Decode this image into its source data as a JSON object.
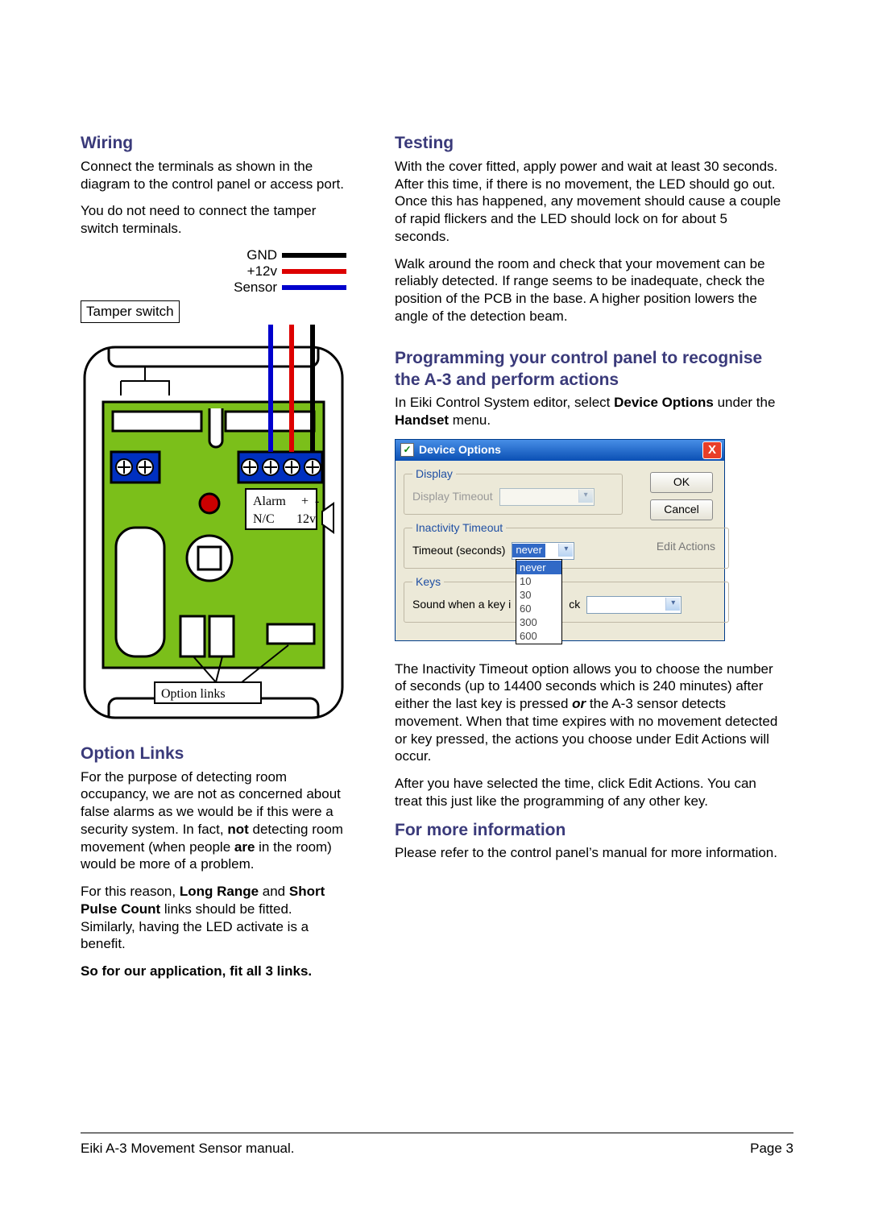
{
  "left": {
    "wiring_h": "Wiring",
    "wiring_p1": "Connect the terminals as shown in the diagram to the control panel or access port.",
    "wiring_p2": "You do not need to connect the tamper switch terminals.",
    "legend_gnd": "GND",
    "legend_12v": "+12v",
    "legend_sensor": "Sensor",
    "tamper_label": "Tamper switch",
    "diagram_alarm": "Alarm",
    "diagram_nc": "N/C",
    "diagram_plus": "+",
    "diagram_minus": "-",
    "diagram_12v": "12v",
    "option_links_box": "Option links",
    "option_links_h": "Option Links",
    "ol_p1_pre": "For the purpose of detecting room occupancy, we are not as concerned about false alarms as we would be if this were a security system. In fact, ",
    "ol_p1_not": "not",
    "ol_p1_mid": " detecting room movement (when people ",
    "ol_p1_are": "are",
    "ol_p1_post": " in the room) would be more of a problem.",
    "ol_p2_pre": "For this reason, ",
    "ol_p2_lr": "Long Range",
    "ol_p2_mid": " and ",
    "ol_p2_spc": "Short Pulse Count",
    "ol_p2_post": " links should be fitted. Similarly, having the LED activate is a benefit.",
    "ol_p3": "So for our application, fit all 3 links."
  },
  "right": {
    "testing_h": "Testing",
    "testing_p1": "With the cover fitted, apply power and wait at least 30 seconds. After this time, if there is no movement, the LED should go out. Once this has happened, any movement should cause a couple of rapid flickers and the LED should lock on for about 5 seconds.",
    "testing_p2": "Walk around the room and check that your movement can be reliably detected. If range seems to be inadequate, check the position of the PCB in the base. A higher position lowers the angle of the detection beam.",
    "prog_h": "Programming your control panel to recognise the A-3 and perform actions",
    "prog_p1_pre": "In Eiki Control System editor, select ",
    "prog_p1_b1": "Device Options",
    "prog_p1_mid": " under the ",
    "prog_p1_b2": "Handset",
    "prog_p1_post": " menu.",
    "inact_p1_pre": "The Inactivity Timeout option allows you to choose the number of seconds (up to 14400 seconds which is 240 minutes) after either the last key is pressed ",
    "inact_or": "or",
    "inact_p1_post": " the A-3 sensor detects movement. When that time expires with no movement detected or key pressed, the actions you choose under Edit Actions will occur.",
    "inact_p2": "After you have selected the time, click Edit Actions. You can treat this just like the programming of any other key.",
    "more_h": "For more information",
    "more_p1": "Please refer to the control panel’s manual for more information."
  },
  "dialog": {
    "title": "Device Options",
    "close_x": "X",
    "ok": "OK",
    "cancel": "Cancel",
    "edit_actions": "Edit Actions",
    "display_legend": "Display",
    "display_timeout_lbl": "Display Timeout",
    "inactivity_legend": "Inactivity Timeout",
    "timeout_lbl": "Timeout (seconds)",
    "timeout_selected": "never",
    "timeout_options": [
      "never",
      "10",
      "30",
      "60",
      "300",
      "600"
    ],
    "keys_legend": "Keys",
    "keys_sound_lbl_l": "Sound when a key i",
    "keys_sound_lbl_r": "ck"
  },
  "footer": {
    "left": "Eiki A-3 Movement Sensor manual.",
    "right": "Page 3"
  }
}
